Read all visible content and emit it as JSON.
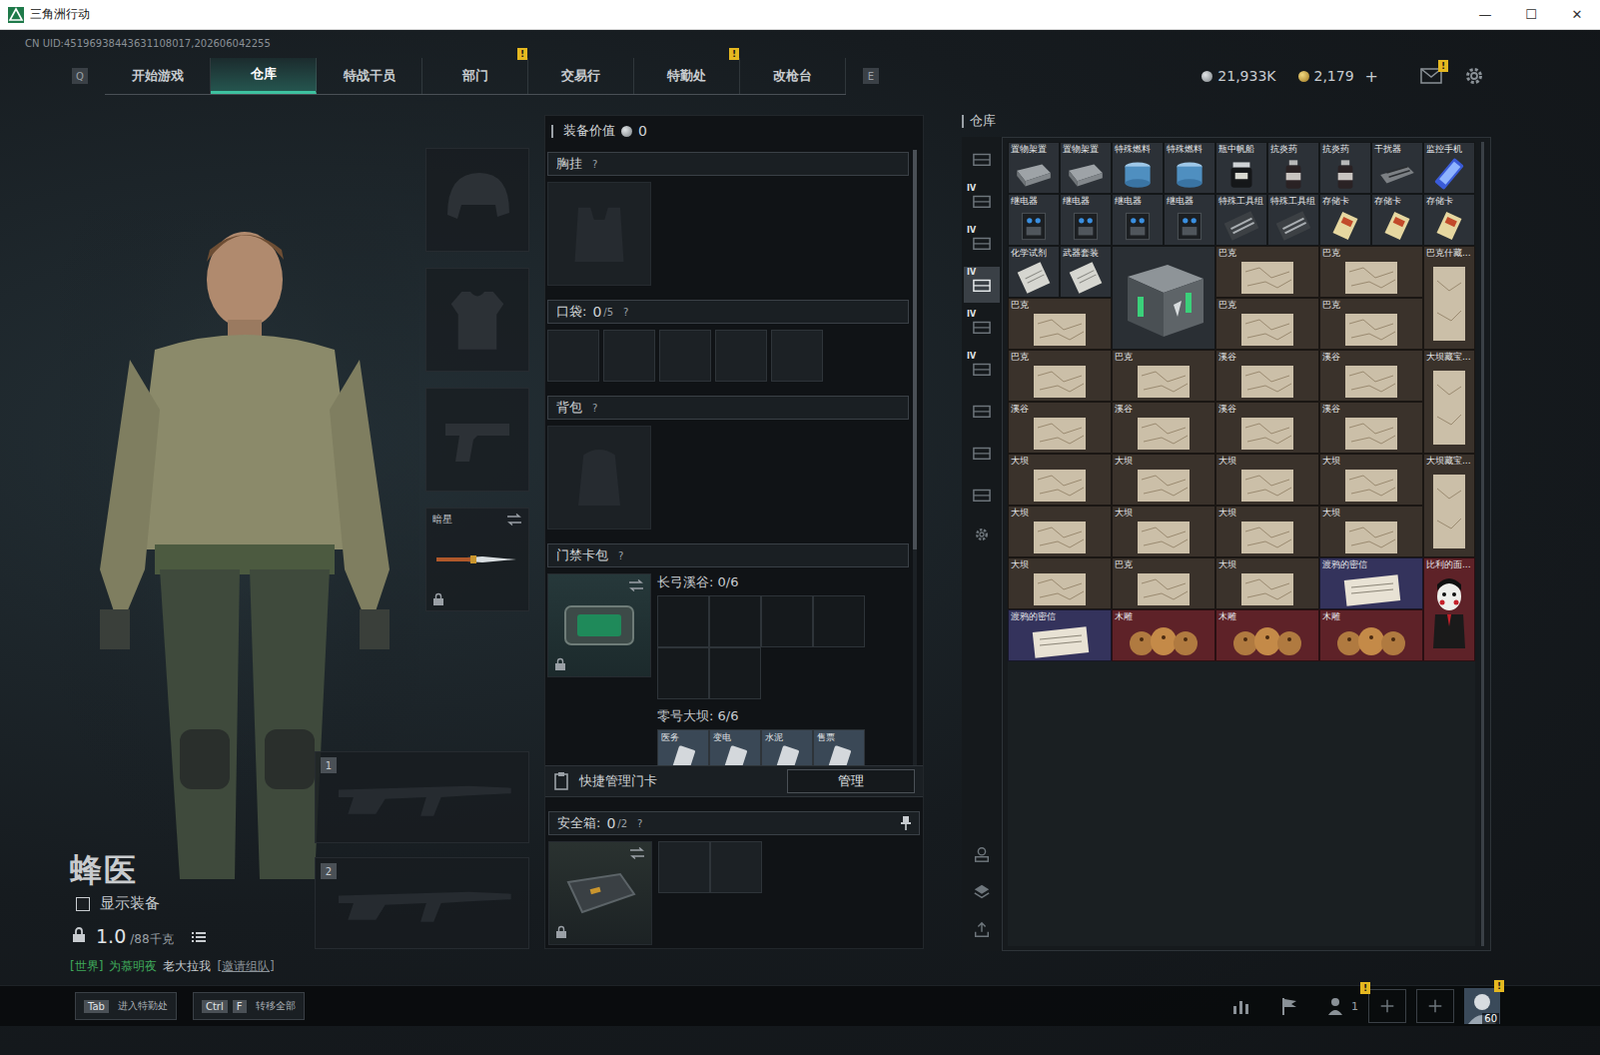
{
  "window": {
    "title": "三角洲行动",
    "controls": [
      "—",
      "☐",
      "✕"
    ]
  },
  "uid": "CN UID:45196938443631108017,202606042255",
  "nav": {
    "prev_key": "Q",
    "next_key": "E",
    "tabs": [
      {
        "label": "开始游戏",
        "selected": false,
        "badge": ""
      },
      {
        "label": "仓库",
        "selected": true,
        "badge": ""
      },
      {
        "label": "特战干员",
        "selected": false,
        "badge": ""
      },
      {
        "label": "部门",
        "selected": false,
        "badge": "!"
      },
      {
        "label": "交易行",
        "selected": false,
        "badge": ""
      },
      {
        "label": "特勤处",
        "selected": false,
        "badge": "!"
      },
      {
        "label": "改枪台",
        "selected": false,
        "badge": ""
      }
    ]
  },
  "currency": {
    "coins": "21,933K",
    "tickets": "2,179",
    "add": "+",
    "mail_badge": "!"
  },
  "operator": {
    "name": "蜂医",
    "show_equipment": {
      "label": "显示装备",
      "checked": false
    },
    "weight": {
      "value": "1.0",
      "max": "/88千克"
    }
  },
  "chat": {
    "channel": "[世界]",
    "sender": "为慕明夜",
    "message": "老大拉我",
    "action": "[邀请组队]"
  },
  "equip_slots": {
    "melee": {
      "label": "暗星",
      "locked": true
    },
    "weapons": [
      "1",
      "2"
    ]
  },
  "loadout": {
    "value_label": "装备价值",
    "value": "0",
    "chest": {
      "title": "胸挂",
      "help": "?"
    },
    "pockets": {
      "title": "口袋:",
      "count": "0",
      "max": "/5",
      "help": "?",
      "slots": [
        {
          "filled": false
        },
        {
          "filled": false
        },
        {
          "filled": false
        },
        {
          "filled": false
        },
        {
          "filled": false
        }
      ]
    },
    "backpack": {
      "title": "背包",
      "help": "?"
    },
    "keycards": {
      "title": "门禁卡包",
      "help": "?",
      "locked": true,
      "regions": [
        {
          "title": "长弓溪谷: 0/6",
          "cards": [
            {
              "label": "",
              "filled": false
            },
            {
              "label": "",
              "filled": false
            },
            {
              "label": "",
              "filled": false
            },
            {
              "label": "",
              "filled": false
            },
            {
              "label": "",
              "filled": false
            },
            {
              "label": "",
              "filled": false
            }
          ]
        },
        {
          "title": "零号大坝: 6/6",
          "cards": [
            {
              "label": "医务",
              "filled": true
            },
            {
              "label": "变电",
              "filled": true
            },
            {
              "label": "水泥",
              "filled": true
            },
            {
              "label": "售票",
              "filled": true
            }
          ]
        }
      ]
    },
    "quick_manage": {
      "label": "快捷管理门卡",
      "button": "管理"
    },
    "safe": {
      "title": "安全箱:",
      "count": "0",
      "max": "/2",
      "help": "?",
      "locked": true,
      "slots": [
        {
          "filled": false
        },
        {
          "filled": false
        }
      ]
    }
  },
  "warehouse": {
    "title": "仓库",
    "tabs": [
      {
        "badge": "",
        "selected": false
      },
      {
        "badge": "IV",
        "selected": false
      },
      {
        "badge": "IV",
        "selected": false
      },
      {
        "badge": "IV",
        "selected": true
      },
      {
        "badge": "IV",
        "selected": false
      },
      {
        "badge": "IV",
        "selected": false
      },
      {
        "badge": "",
        "selected": false
      },
      {
        "badge": "",
        "selected": false
      },
      {
        "badge": "",
        "selected": false
      }
    ],
    "items": [
      {
        "label": "置物架置",
        "kind": "shelf",
        "color": "#2c3137"
      },
      {
        "label": "置物架置",
        "kind": "shelf",
        "color": "#2c3137"
      },
      {
        "label": "特殊燃料",
        "kind": "fuel",
        "color": "#2c3137"
      },
      {
        "label": "特殊燃料",
        "kind": "fuel",
        "color": "#2c3137"
      },
      {
        "label": "瓶中帆船",
        "kind": "ship",
        "color": "#2c3137"
      },
      {
        "label": "抗炎药",
        "kind": "medicine",
        "color": "#2c3137"
      },
      {
        "label": "抗炎药",
        "kind": "medicine",
        "color": "#2c3137"
      },
      {
        "label": "干扰器",
        "kind": "jammer",
        "color": "#2c3137"
      },
      {
        "label": "监控手机",
        "kind": "phone",
        "color": "#2c3137"
      },
      {
        "label": "继电器",
        "kind": "relay",
        "color": "#2c3137"
      },
      {
        "label": "继电器",
        "kind": "relay",
        "color": "#2c3137"
      },
      {
        "label": "继电器",
        "kind": "relay",
        "color": "#2c3137"
      },
      {
        "label": "继电器",
        "kind": "relay",
        "color": "#2c3137"
      },
      {
        "label": "特殊工具组",
        "kind": "toolkit",
        "color": "#2c3137"
      },
      {
        "label": "特殊工具组",
        "kind": "toolkit",
        "color": "#2c3137"
      },
      {
        "label": "存储卡",
        "kind": "card",
        "color": "#2c3137"
      },
      {
        "label": "存储卡",
        "kind": "card",
        "color": "#2c3137"
      },
      {
        "label": "存储卡",
        "kind": "card",
        "color": "#2c3137"
      },
      {
        "label": "化学试剂",
        "kind": "paper",
        "color": "#2c3137"
      },
      {
        "label": "武器套装",
        "kind": "paper",
        "color": "#2c3137"
      },
      {
        "label": "",
        "kind": "crate",
        "color": "#2a2f34"
      },
      {
        "label": "巴克",
        "kind": "map",
        "color": "#3a322b"
      },
      {
        "label": "巴克",
        "kind": "map",
        "color": "#3a322b"
      },
      {
        "label": "巴克什藏...",
        "kind": "map-tall",
        "color": "#3a322b"
      },
      {
        "label": "巴克",
        "kind": "map",
        "color": "#3a322b"
      },
      {
        "label": "巴克",
        "kind": "map",
        "color": "#3a322b"
      },
      {
        "label": "巴克",
        "kind": "map",
        "color": "#3a322b"
      },
      {
        "label": "巴克",
        "kind": "map",
        "color": "#3a322b"
      },
      {
        "label": "巴克",
        "kind": "map",
        "color": "#3a322b"
      },
      {
        "label": "溪谷",
        "kind": "map",
        "color": "#3a322b"
      },
      {
        "label": "溪谷",
        "kind": "map",
        "color": "#3a322b"
      },
      {
        "label": "大坝藏宝...",
        "kind": "map-tall",
        "color": "#3a322b"
      },
      {
        "label": "溪谷",
        "kind": "map",
        "color": "#3a322b"
      },
      {
        "label": "溪谷",
        "kind": "map",
        "color": "#3a322b"
      },
      {
        "label": "溪谷",
        "kind": "map",
        "color": "#3a322b"
      },
      {
        "label": "溪谷",
        "kind": "map",
        "color": "#3a322b"
      },
      {
        "label": "大坝",
        "kind": "map",
        "color": "#3a322b"
      },
      {
        "label": "大坝",
        "kind": "map",
        "color": "#3a322b"
      },
      {
        "label": "大坝",
        "kind": "map",
        "color": "#3a322b"
      },
      {
        "label": "大坝",
        "kind": "map",
        "color": "#3a322b"
      },
      {
        "label": "大坝藏宝...",
        "kind": "map-tall",
        "color": "#3a322b"
      },
      {
        "label": "大坝",
        "kind": "map",
        "color": "#3a322b"
      },
      {
        "label": "大坝",
        "kind": "map",
        "color": "#3a322b"
      },
      {
        "label": "大坝",
        "kind": "map",
        "color": "#3a322b"
      },
      {
        "label": "大坝",
        "kind": "map",
        "color": "#3a322b"
      },
      {
        "label": "大坝",
        "kind": "map",
        "color": "#3a322b"
      },
      {
        "label": "巴克",
        "kind": "map",
        "color": "#3a322b"
      },
      {
        "label": "大坝",
        "kind": "map",
        "color": "#3a322b"
      },
      {
        "label": "渡鸦的密信",
        "kind": "letter",
        "color": "#34335c"
      },
      {
        "label": "比利的面...",
        "kind": "puppet",
        "color": "#5e2228"
      },
      {
        "label": "渡鸦的密信",
        "kind": "letter",
        "color": "#34335c"
      },
      {
        "label": "木雕",
        "kind": "carving",
        "color": "#5e2228"
      },
      {
        "label": "木雕",
        "kind": "carving",
        "color": "#5e2228"
      },
      {
        "label": "木雕",
        "kind": "carving",
        "color": "#5e2228"
      }
    ]
  },
  "hotkeys": [
    {
      "keys": [
        "Tab"
      ],
      "label": "进入特勤处"
    },
    {
      "keys": [
        "Ctrl",
        "F"
      ],
      "label": "转移全部"
    }
  ],
  "social": {
    "friends": "1",
    "friends_badge": "!",
    "level": "60",
    "avatar_badge": "!"
  }
}
